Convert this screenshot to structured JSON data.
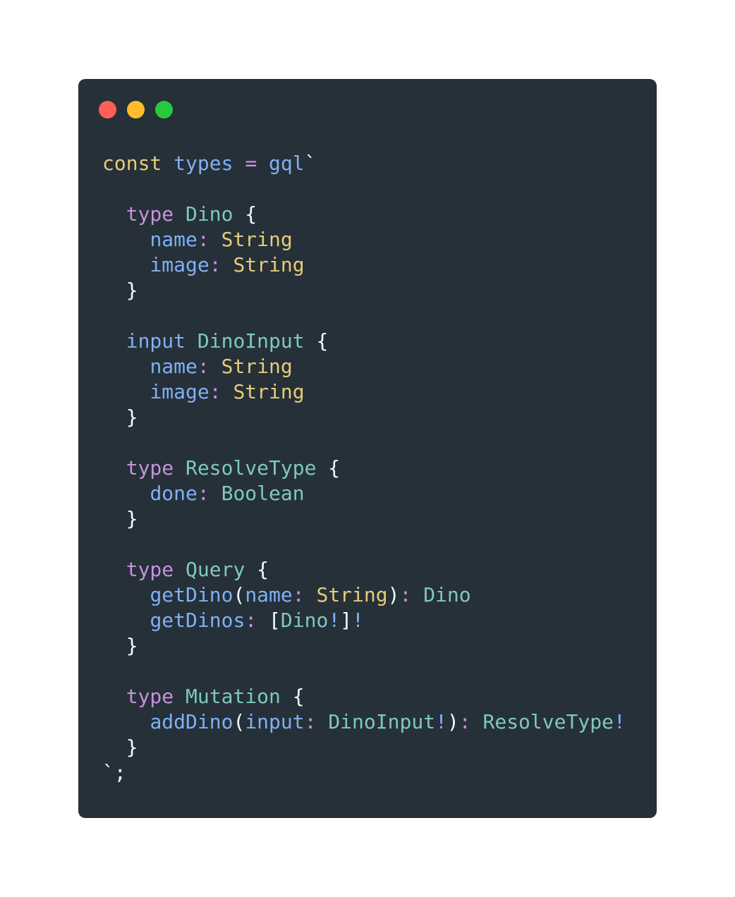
{
  "window": {
    "controls": [
      {
        "name": "close",
        "color": "#ff5f56"
      },
      {
        "name": "minimize",
        "color": "#ffbd2e"
      },
      {
        "name": "maximize",
        "color": "#27c93f"
      }
    ]
  },
  "code": {
    "language": "javascript",
    "lines": [
      [
        {
          "t": "const",
          "c": "kw"
        },
        {
          "t": " ",
          "c": "punc"
        },
        {
          "t": "types",
          "c": "var"
        },
        {
          "t": " ",
          "c": "punc"
        },
        {
          "t": "=",
          "c": "op"
        },
        {
          "t": " ",
          "c": "punc"
        },
        {
          "t": "gql",
          "c": "var"
        },
        {
          "t": "`",
          "c": "punc"
        }
      ],
      [],
      [
        {
          "t": "  ",
          "c": "punc"
        },
        {
          "t": "type",
          "c": "type"
        },
        {
          "t": " ",
          "c": "punc"
        },
        {
          "t": "Dino",
          "c": "name"
        },
        {
          "t": " {",
          "c": "punc"
        }
      ],
      [
        {
          "t": "    ",
          "c": "punc"
        },
        {
          "t": "name",
          "c": "field"
        },
        {
          "t": ":",
          "c": "op"
        },
        {
          "t": " ",
          "c": "punc"
        },
        {
          "t": "String",
          "c": "str"
        }
      ],
      [
        {
          "t": "    ",
          "c": "punc"
        },
        {
          "t": "image",
          "c": "field"
        },
        {
          "t": ":",
          "c": "op"
        },
        {
          "t": " ",
          "c": "punc"
        },
        {
          "t": "String",
          "c": "str"
        }
      ],
      [
        {
          "t": "  }",
          "c": "punc"
        }
      ],
      [],
      [
        {
          "t": "  ",
          "c": "punc"
        },
        {
          "t": "input",
          "c": "var"
        },
        {
          "t": " ",
          "c": "punc"
        },
        {
          "t": "DinoInput",
          "c": "name"
        },
        {
          "t": " {",
          "c": "punc"
        }
      ],
      [
        {
          "t": "    ",
          "c": "punc"
        },
        {
          "t": "name",
          "c": "field"
        },
        {
          "t": ":",
          "c": "op"
        },
        {
          "t": " ",
          "c": "punc"
        },
        {
          "t": "String",
          "c": "str"
        }
      ],
      [
        {
          "t": "    ",
          "c": "punc"
        },
        {
          "t": "image",
          "c": "field"
        },
        {
          "t": ":",
          "c": "op"
        },
        {
          "t": " ",
          "c": "punc"
        },
        {
          "t": "String",
          "c": "str"
        }
      ],
      [
        {
          "t": "  }",
          "c": "punc"
        }
      ],
      [],
      [
        {
          "t": "  ",
          "c": "punc"
        },
        {
          "t": "type",
          "c": "type"
        },
        {
          "t": " ",
          "c": "punc"
        },
        {
          "t": "ResolveType",
          "c": "name"
        },
        {
          "t": " {",
          "c": "punc"
        }
      ],
      [
        {
          "t": "    ",
          "c": "punc"
        },
        {
          "t": "done",
          "c": "field"
        },
        {
          "t": ":",
          "c": "op"
        },
        {
          "t": " ",
          "c": "punc"
        },
        {
          "t": "Boolean",
          "c": "name"
        }
      ],
      [
        {
          "t": "  }",
          "c": "punc"
        }
      ],
      [],
      [
        {
          "t": "  ",
          "c": "punc"
        },
        {
          "t": "type",
          "c": "type"
        },
        {
          "t": " ",
          "c": "punc"
        },
        {
          "t": "Query",
          "c": "name"
        },
        {
          "t": " {",
          "c": "punc"
        }
      ],
      [
        {
          "t": "    ",
          "c": "punc"
        },
        {
          "t": "getDino",
          "c": "field"
        },
        {
          "t": "(",
          "c": "punc"
        },
        {
          "t": "name",
          "c": "field"
        },
        {
          "t": ":",
          "c": "op"
        },
        {
          "t": " ",
          "c": "punc"
        },
        {
          "t": "String",
          "c": "str"
        },
        {
          "t": ")",
          "c": "punc"
        },
        {
          "t": ":",
          "c": "op"
        },
        {
          "t": " ",
          "c": "punc"
        },
        {
          "t": "Dino",
          "c": "name"
        }
      ],
      [
        {
          "t": "    ",
          "c": "punc"
        },
        {
          "t": "getDinos",
          "c": "field"
        },
        {
          "t": ":",
          "c": "op"
        },
        {
          "t": " ",
          "c": "punc"
        },
        {
          "t": "[",
          "c": "punc"
        },
        {
          "t": "Dino",
          "c": "name"
        },
        {
          "t": "!",
          "c": "bang"
        },
        {
          "t": "]",
          "c": "punc"
        },
        {
          "t": "!",
          "c": "bang"
        }
      ],
      [
        {
          "t": "  }",
          "c": "punc"
        }
      ],
      [],
      [
        {
          "t": "  ",
          "c": "punc"
        },
        {
          "t": "type",
          "c": "type"
        },
        {
          "t": " ",
          "c": "punc"
        },
        {
          "t": "Mutation",
          "c": "name"
        },
        {
          "t": " {",
          "c": "punc"
        }
      ],
      [
        {
          "t": "    ",
          "c": "punc"
        },
        {
          "t": "addDino",
          "c": "field"
        },
        {
          "t": "(",
          "c": "punc"
        },
        {
          "t": "input",
          "c": "field"
        },
        {
          "t": ":",
          "c": "op"
        },
        {
          "t": " ",
          "c": "punc"
        },
        {
          "t": "DinoInput",
          "c": "name"
        },
        {
          "t": "!",
          "c": "bang"
        },
        {
          "t": ")",
          "c": "punc"
        },
        {
          "t": ":",
          "c": "op"
        },
        {
          "t": " ",
          "c": "punc"
        },
        {
          "t": "ResolveType",
          "c": "name"
        },
        {
          "t": "!",
          "c": "bang"
        }
      ],
      [
        {
          "t": "  }",
          "c": "punc"
        }
      ],
      [
        {
          "t": "`;",
          "c": "punc"
        }
      ]
    ]
  }
}
